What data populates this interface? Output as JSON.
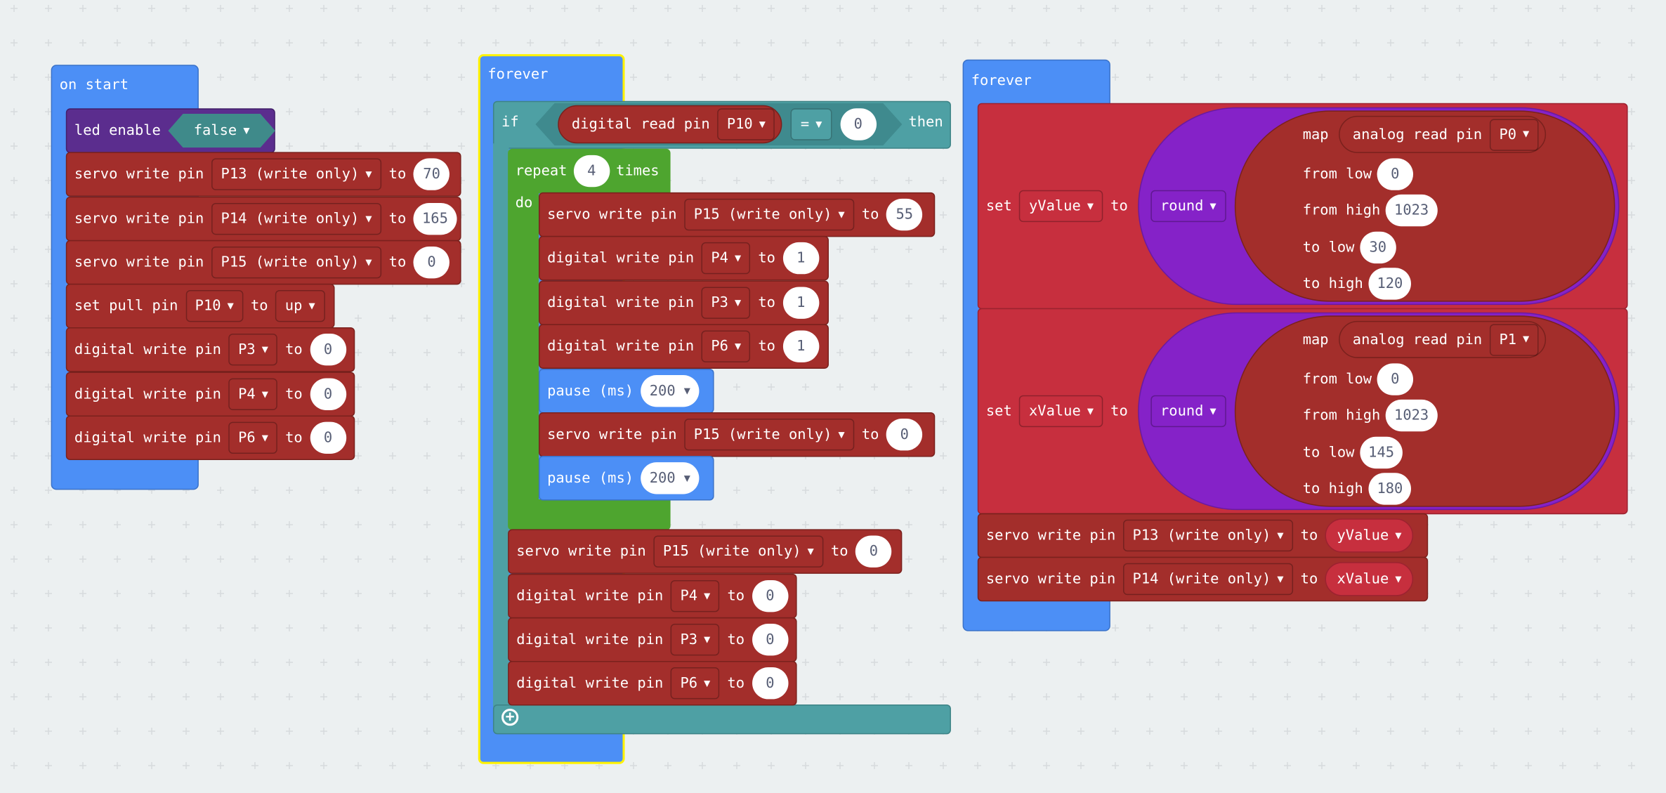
{
  "colors": {
    "workspace": "#ECF0F1",
    "basic": "#4C8FF6",
    "pins": "#A32E2B",
    "logic": "#4EA0A4",
    "loops": "#4EA52F",
    "variables": "#C72F3E",
    "math": "#8522C8",
    "led": "#5B2D8E",
    "selected_outline": "#FFF200"
  },
  "on_start": {
    "label": "on start",
    "led": {
      "label": "led enable",
      "value": "false"
    },
    "servo": [
      {
        "label": "servo write pin",
        "pin": "P13 (write only)",
        "to": "to",
        "value": "70"
      },
      {
        "label": "servo write pin",
        "pin": "P14 (write only)",
        "to": "to",
        "value": "165"
      },
      {
        "label": "servo write pin",
        "pin": "P15 (write only)",
        "to": "to",
        "value": "0"
      }
    ],
    "pull": {
      "label": "set pull pin",
      "pin": "P10",
      "to": "to",
      "mode": "up"
    },
    "digital": [
      {
        "label": "digital write pin",
        "pin": "P3",
        "to": "to",
        "value": "0"
      },
      {
        "label": "digital write pin",
        "pin": "P4",
        "to": "to",
        "value": "0"
      },
      {
        "label": "digital write pin",
        "pin": "P6",
        "to": "to",
        "value": "0"
      }
    ]
  },
  "forever1": {
    "label": "forever",
    "if": {
      "label": "if",
      "cond_label": "digital read pin",
      "cond_pin": "P10",
      "op": "=",
      "value": "0",
      "then": "then"
    },
    "repeat": {
      "label": "repeat",
      "count": "4",
      "times": "times",
      "do": "do",
      "body": [
        {
          "label": "servo write pin",
          "pin": "P15 (write only)",
          "to": "to",
          "value": "55"
        },
        {
          "label": "digital write pin",
          "pin": "P4",
          "to": "to",
          "value": "1"
        },
        {
          "label": "digital write pin",
          "pin": "P3",
          "to": "to",
          "value": "1"
        },
        {
          "label": "digital write pin",
          "pin": "P6",
          "to": "to",
          "value": "1"
        },
        {
          "label": "pause (ms)",
          "value": "200"
        },
        {
          "label": "servo write pin",
          "pin": "P15 (write only)",
          "to": "to",
          "value": "0"
        },
        {
          "label": "pause (ms)",
          "value": "200"
        }
      ]
    },
    "after": [
      {
        "label": "servo write pin",
        "pin": "P15 (write only)",
        "to": "to",
        "value": "0"
      },
      {
        "label": "digital write pin",
        "pin": "P4",
        "to": "to",
        "value": "0"
      },
      {
        "label": "digital write pin",
        "pin": "P3",
        "to": "to",
        "value": "0"
      },
      {
        "label": "digital write pin",
        "pin": "P6",
        "to": "to",
        "value": "0"
      }
    ]
  },
  "forever2": {
    "label": "forever",
    "sets": [
      {
        "set": "set",
        "var": "yValue",
        "to": "to",
        "func": "round",
        "map": "map",
        "read": "analog read pin",
        "pin": "P0",
        "from_low_label": "from low",
        "from_low": "0",
        "from_high_label": "from high",
        "from_high": "1023",
        "to_low_label": "to low",
        "to_low": "30",
        "to_high_label": "to high",
        "to_high": "120"
      },
      {
        "set": "set",
        "var": "xValue",
        "to": "to",
        "func": "round",
        "map": "map",
        "read": "analog read pin",
        "pin": "P1",
        "from_low_label": "from low",
        "from_low": "0",
        "from_high_label": "from high",
        "from_high": "1023",
        "to_low_label": "to low",
        "to_low": "145",
        "to_high_label": "to high",
        "to_high": "180"
      }
    ],
    "servo": [
      {
        "label": "servo write pin",
        "pin": "P13 (write only)",
        "to": "to",
        "var": "yValue"
      },
      {
        "label": "servo write pin",
        "pin": "P14 (write only)",
        "to": "to",
        "var": "xValue"
      }
    ]
  }
}
